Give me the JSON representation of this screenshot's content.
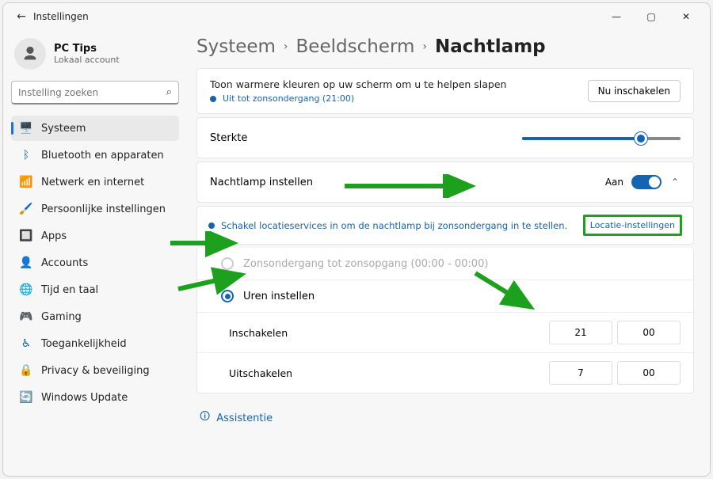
{
  "titlebar": {
    "title": "Instellingen"
  },
  "account": {
    "name": "PC Tips",
    "sub": "Lokaal account"
  },
  "search": {
    "placeholder": "Instelling zoeken"
  },
  "nav": {
    "items": [
      {
        "label": "Systeem",
        "icon": "🖥️"
      },
      {
        "label": "Bluetooth en apparaten",
        "icon": "ᛒ"
      },
      {
        "label": "Netwerk en internet",
        "icon": "📶"
      },
      {
        "label": "Persoonlijke instellingen",
        "icon": "🖌️"
      },
      {
        "label": "Apps",
        "icon": "🔲"
      },
      {
        "label": "Accounts",
        "icon": "👤"
      },
      {
        "label": "Tijd en taal",
        "icon": "🌐"
      },
      {
        "label": "Gaming",
        "icon": "🎮"
      },
      {
        "label": "Toegankelijkheid",
        "icon": "♿"
      },
      {
        "label": "Privacy & beveiliging",
        "icon": "🔒"
      },
      {
        "label": "Windows Update",
        "icon": "🔄"
      }
    ]
  },
  "breadcrumb": {
    "p1": "Systeem",
    "p2": "Beeldscherm",
    "p3": "Nachtlamp"
  },
  "hero": {
    "desc": "Toon warmere kleuren op uw scherm om u te helpen slapen",
    "status": "Uit tot zonsondergang (21:00)",
    "button": "Nu inschakelen"
  },
  "strength": {
    "label": "Sterkte"
  },
  "schedule": {
    "label": "Nachtlamp instellen",
    "state": "Aan"
  },
  "banner": {
    "text": "Schakel locatieservices in om de nachtlamp bij zonsondergang in te stellen.",
    "button": "Locatie-instellingen"
  },
  "opt1": {
    "label": "Zonsondergang tot zonsopgang (00:00 - 00:00)"
  },
  "opt2": {
    "label": "Uren instellen"
  },
  "on": {
    "label": "Inschakelen",
    "h": "21",
    "m": "00"
  },
  "off": {
    "label": "Uitschakelen",
    "h": "7",
    "m": "00"
  },
  "assist": {
    "label": "Assistentie"
  },
  "colors": {
    "nav-icons": [
      "#0b63a4",
      "#0b63a4",
      "#0b63a4",
      "#cc7a00",
      "#b33b7a",
      "#e09b00",
      "#0b63a4",
      "#5aa657",
      "#0b63a4",
      "#0b63a4",
      "#e09b00"
    ]
  }
}
